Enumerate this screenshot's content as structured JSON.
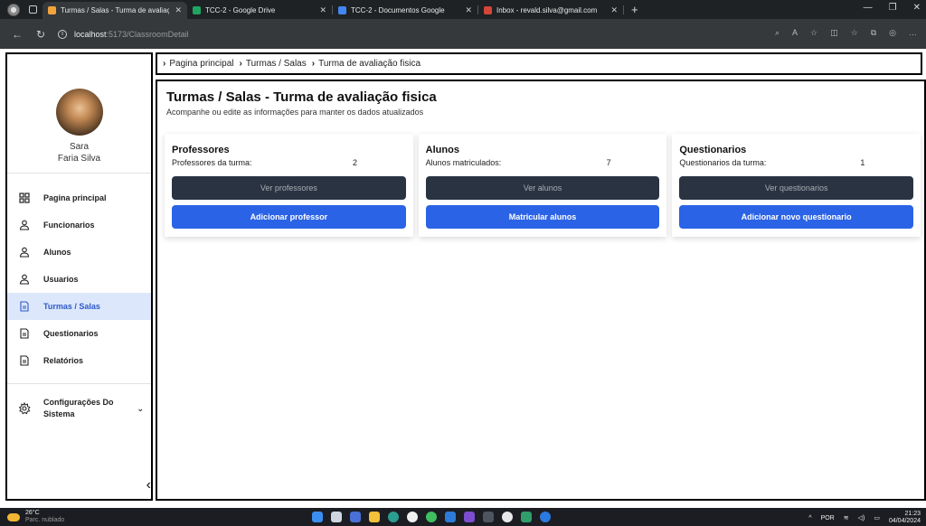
{
  "browser": {
    "tabs": [
      {
        "title": "Turmas / Salas - Turma de avaliação",
        "active": true,
        "favicon_color": "#f2a33a"
      },
      {
        "title": "TCC-2 - Google Drive",
        "active": false,
        "favicon_color": "#1fa463"
      },
      {
        "title": "TCC-2 - Documentos Google",
        "active": false,
        "favicon_color": "#4285f4"
      },
      {
        "title": "Inbox - revald.silva@gmail.com",
        "active": false,
        "favicon_color": "#d44638"
      }
    ],
    "url_host": "localhost",
    "url_path": ":5173/ClassroomDetail"
  },
  "sidebar": {
    "user": {
      "first_name": "Sara",
      "last_name": "Faria Silva"
    },
    "items": [
      {
        "label": "Pagina principal",
        "icon": "grid-icon",
        "active": false
      },
      {
        "label": "Funcionarios",
        "icon": "user-icon",
        "active": false
      },
      {
        "label": "Alunos",
        "icon": "user-icon",
        "active": false
      },
      {
        "label": "Usuarios",
        "icon": "user-icon",
        "active": false
      },
      {
        "label": "Turmas / Salas",
        "icon": "document-icon",
        "active": true
      },
      {
        "label": "Questionarios",
        "icon": "document-icon",
        "active": false
      },
      {
        "label": "Relatórios",
        "icon": "document-icon",
        "active": false
      }
    ],
    "config_label": "Configurações Do Sistema"
  },
  "breadcrumb": [
    "Pagina principal",
    "Turmas / Salas",
    "Turma de avaliação fisica"
  ],
  "page": {
    "title": "Turmas / Salas - Turma de avaliação fisica",
    "subtitle": "Acompanhe ou edite as informações para manter os dados atualizados"
  },
  "cards": [
    {
      "title": "Professores",
      "label": "Professores da turma:",
      "value": "2",
      "view_btn": "Ver professores",
      "action_btn": "Adicionar professor"
    },
    {
      "title": "Alunos",
      "label": "Alunos matriculados:",
      "value": "7",
      "view_btn": "Ver alunos",
      "action_btn": "Matricular alunos"
    },
    {
      "title": "Questionarios",
      "label": "Questionarios da turma:",
      "value": "1",
      "view_btn": "Ver questionarios",
      "action_btn": "Adicionar novo questionario"
    }
  ],
  "taskbar": {
    "temp": "26°C",
    "weather_text": "Parc. nublado",
    "lang": "POR",
    "time": "21:23",
    "date": "04/04/2024"
  },
  "colors": {
    "accent_blue": "#2b63e6",
    "dark_button": "#2a3341",
    "active_menu_bg": "#dce7fb"
  }
}
